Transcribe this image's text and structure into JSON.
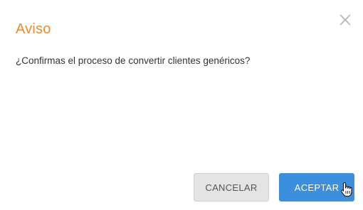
{
  "dialog": {
    "title": "Aviso",
    "message": "¿Confirmas el proceso de convertir clientes genéricos?",
    "close_icon": "close-icon",
    "buttons": {
      "cancel_label": "CANCELAR",
      "accept_label": "ACEPTAR"
    }
  },
  "colors": {
    "title": "#ec8a2c",
    "accept_button": "#3b8fdc",
    "cancel_button": "#e4e4e4"
  }
}
